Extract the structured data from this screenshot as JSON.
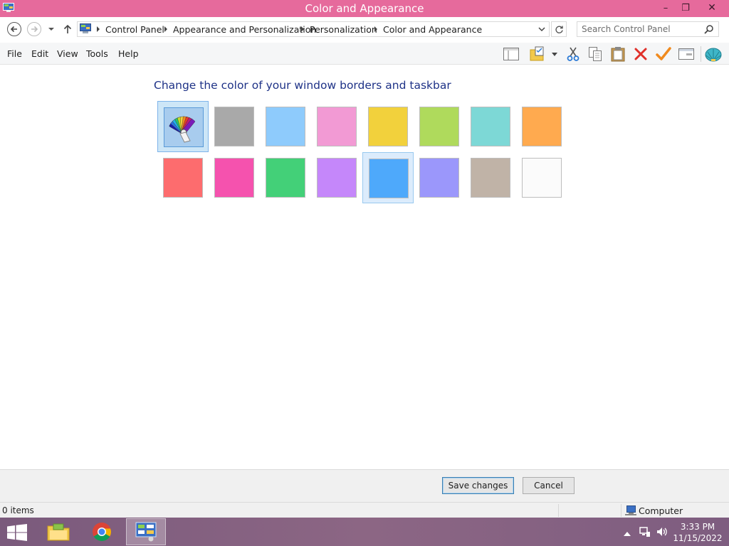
{
  "window": {
    "title": "Color and Appearance",
    "controls": {
      "minimize_glyph": "–",
      "restore_glyph": "❐",
      "close_glyph": "✕"
    }
  },
  "address_bar": {
    "breadcrumbs": [
      "Control Panel",
      "Appearance and Personalization",
      "Personalization",
      "Color and Appearance"
    ],
    "root_icon": "control-panel-icon"
  },
  "search": {
    "placeholder": "Search Control Panel"
  },
  "menu": {
    "items": [
      "File",
      "Edit",
      "View",
      "Tools",
      "Help"
    ]
  },
  "toolbar": {
    "icons": [
      "layout-pane-icon",
      "properties-folder-icon",
      "dropdown-icon",
      "cut-icon",
      "copy-icon",
      "paste-icon",
      "delete-icon",
      "check-icon",
      "window-icon",
      "shell-icon"
    ]
  },
  "content": {
    "heading": "Change the color of your window borders and taskbar",
    "swatches": [
      {
        "name": "custom-color-picker",
        "color": "#a8ccee",
        "picker": true
      },
      {
        "name": "gray",
        "color": "#a9a9a9"
      },
      {
        "name": "sky-blue",
        "color": "#8ecbfc"
      },
      {
        "name": "pink",
        "color": "#f29ad4"
      },
      {
        "name": "yellow",
        "color": "#f2d13c"
      },
      {
        "name": "lime",
        "color": "#afda5c"
      },
      {
        "name": "teal",
        "color": "#7dd8d6"
      },
      {
        "name": "orange",
        "color": "#ffaa4f"
      },
      {
        "name": "coral-red",
        "color": "#fd6c6e"
      },
      {
        "name": "magenta-pink",
        "color": "#f552ae"
      },
      {
        "name": "green",
        "color": "#43d078"
      },
      {
        "name": "lavender",
        "color": "#c587fa"
      },
      {
        "name": "blue",
        "color": "#4ea9fb",
        "selected": true
      },
      {
        "name": "periwinkle",
        "color": "#9b97fb"
      },
      {
        "name": "taupe",
        "color": "#c0b3a7"
      },
      {
        "name": "white",
        "color": "#fbfbfb"
      }
    ]
  },
  "buttons": {
    "save": "Save changes",
    "cancel": "Cancel"
  },
  "status": {
    "items": "0 items",
    "location": "Computer"
  },
  "taskbar": {
    "apps": [
      "file-explorer-icon",
      "chrome-icon",
      "control-panel-icon"
    ],
    "active_app": "control-panel-icon",
    "time": "3:33 PM",
    "date": "11/15/2022"
  },
  "colors": {
    "titlebar": "#e66a9c",
    "heading": "#1e3287",
    "selection_border": "#99c9ef"
  }
}
